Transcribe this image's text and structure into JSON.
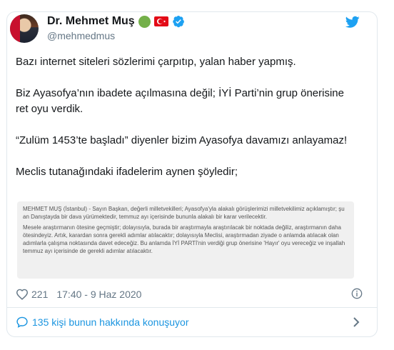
{
  "author": {
    "name": "Dr. Mehmet Muş",
    "handle": "@mehmedmus"
  },
  "tweet": {
    "paragraphs": [
      "Bazı internet siteleri sözlerimi çarpıtıp, yalan haber yapmış.",
      "Biz Ayasofya’nın ibadete açılmasına değil; İYİ Parti’nin grup önerisine ret oyu verdik.",
      "“Zulüm 1453’te başladı” diyenler bizim Ayasofya davamızı anlayamaz!",
      "Meclis tutanağındaki ifadelerim aynen şöyledir;"
    ]
  },
  "quote_image": {
    "paragraphs": [
      "MEHMET MUŞ (İstanbul) - Sayın Başkan, değerli milletvekilleri; Ayasofya'yla alakalı görüşlerimizi milletvekilimiz açıklamıştır; şu an Danıştayda bir dava yürümektedir, temmuz ayı içerisinde bununla alakalı bir karar verilecektir.",
      "Mesele araştırmanın ötesine geçmiştir; dolayısıyla, burada bir araştırmayla araştırılacak bir noktada değiliz, araştırmanın daha ötesindeyiz. Artık, karardan sonra gerekli adımlar atılacaktır; dolayısıyla Meclisi, araştırmadan ziyade o anlamda atılacak olan adımlarla çalışma noktasında davet edeceğiz. Bu anlamda İYİ PARTİ'nin verdiği grup önerisine 'Hayır' oyu vereceğiz ve inşallah temmuz ayı içerisinde de gerekli adımlar atılacaktır."
    ]
  },
  "meta": {
    "likes": "221",
    "timestamp": "17:40 - 9 Haz 2020"
  },
  "footer": {
    "conversation_label": "135 kişi bunun hakkında konuşuyor"
  },
  "icons": {
    "brand": "twitter-bird",
    "like": "heart-outline",
    "info": "info-circle",
    "conversation": "speech-bubble",
    "chevron": "chevron-right",
    "badges": [
      "green-circle",
      "turkey-flag",
      "verified-badge"
    ]
  },
  "colors": {
    "twitter_blue": "#1da1f2",
    "link_blue": "#1b95e0",
    "secondary_text": "#657786",
    "border": "#e1e8ed",
    "quote_bg": "#f0f0f0",
    "green_badge": "#74b04a",
    "flag_red": "#e30a17"
  }
}
